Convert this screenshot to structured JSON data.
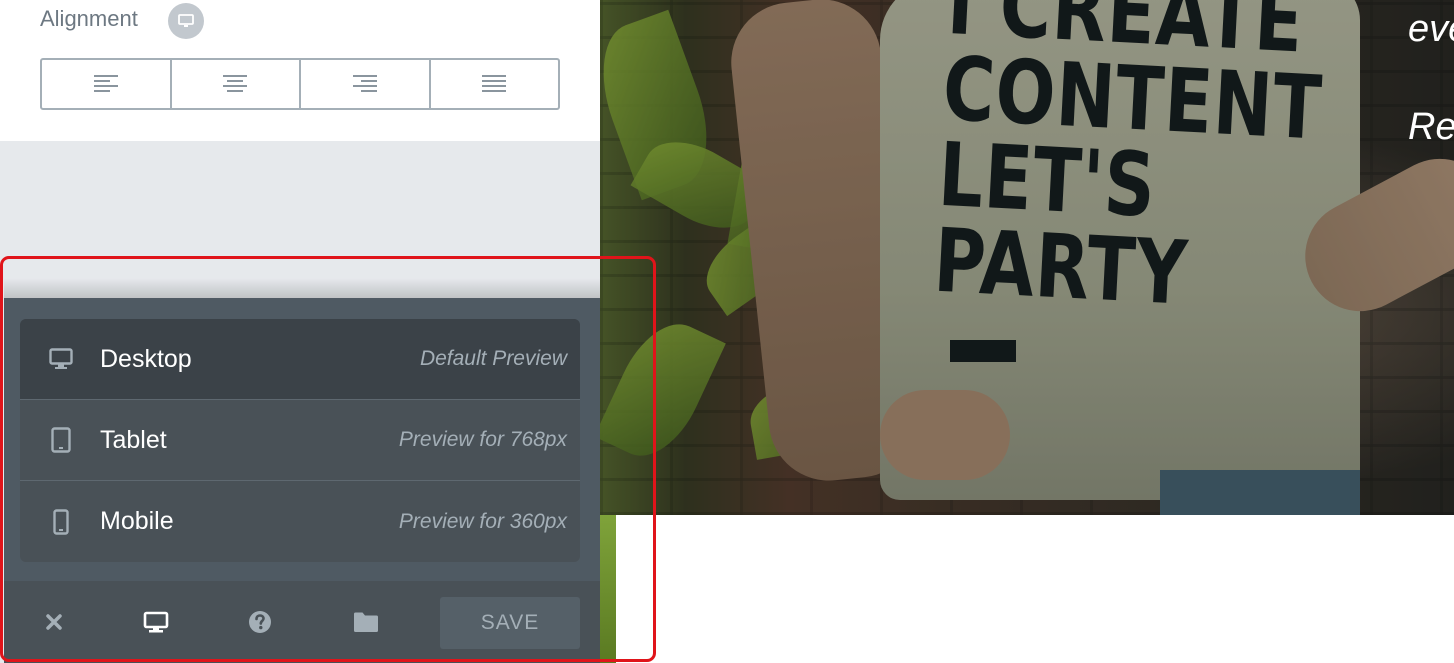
{
  "alignment": {
    "label": "Alignment",
    "responsive_icon": "desktop-icon",
    "options": [
      {
        "name": "align-left",
        "icon": "align-left-icon"
      },
      {
        "name": "align-center",
        "icon": "align-center-icon"
      },
      {
        "name": "align-right",
        "icon": "align-right-icon"
      },
      {
        "name": "align-justify",
        "icon": "align-justify-icon"
      }
    ]
  },
  "responsive_menu": {
    "items": [
      {
        "label": "Desktop",
        "description": "Default Preview",
        "icon": "desktop-icon",
        "active": true
      },
      {
        "label": "Tablet",
        "description": "Preview for 768px",
        "icon": "tablet-icon",
        "active": false
      },
      {
        "label": "Mobile",
        "description": "Preview for 360px",
        "icon": "mobile-icon",
        "active": false
      }
    ]
  },
  "footer": {
    "buttons": [
      {
        "name": "close",
        "icon": "close-icon"
      },
      {
        "name": "responsive-mode",
        "icon": "desktop-icon"
      },
      {
        "name": "help",
        "icon": "help-icon"
      },
      {
        "name": "templates",
        "icon": "folder-icon"
      }
    ],
    "save_label": "SAVE"
  },
  "preview": {
    "shirt_text": "I CREATE\nCONTENT\nLET'S\nPARTY",
    "side_text_1": "eve",
    "side_text_2": "Rea"
  },
  "colors": {
    "panel_dark": "#495157",
    "panel_active": "#3b4248",
    "muted_text": "#a4afb7",
    "highlight": "#e0141a"
  }
}
